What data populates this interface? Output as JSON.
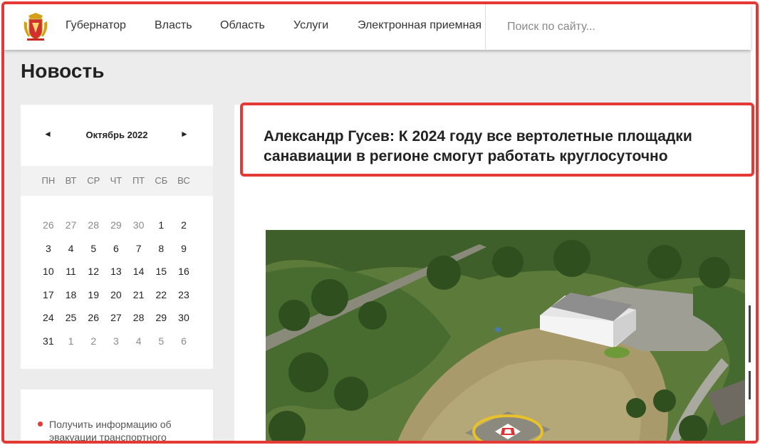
{
  "header": {
    "nav": [
      {
        "label": "Губернатор"
      },
      {
        "label": "Власть"
      },
      {
        "label": "Область"
      },
      {
        "label": "Услуги"
      },
      {
        "label": "Электронная приемная"
      }
    ],
    "search_placeholder": "Поиск по сайту..."
  },
  "page": {
    "title": "Новость"
  },
  "calendar": {
    "prev": "◄",
    "next": "►",
    "month": "Октябрь 2022",
    "weekdays": [
      "ПН",
      "ВТ",
      "СР",
      "ЧТ",
      "ПТ",
      "СБ",
      "ВС"
    ],
    "weeks": [
      [
        "26",
        "27",
        "28",
        "29",
        "30",
        "1",
        "2"
      ],
      [
        "3",
        "4",
        "5",
        "6",
        "7",
        "8",
        "9"
      ],
      [
        "10",
        "11",
        "12",
        "13",
        "14",
        "15",
        "16"
      ],
      [
        "17",
        "18",
        "19",
        "20",
        "21",
        "22",
        "23"
      ],
      [
        "24",
        "25",
        "26",
        "27",
        "28",
        "29",
        "30"
      ],
      [
        "31",
        "1",
        "2",
        "3",
        "4",
        "5",
        "6"
      ]
    ]
  },
  "sidebar": {
    "link": "Получить информацию об эвакуации транспортного"
  },
  "article": {
    "headline_line1": "Александр Гусев: К 2024 году все вертолетные площадки",
    "headline_line2": "санавиации в регионе смогут работать круглосуточно"
  },
  "colors": {
    "accent": "#e53935",
    "background": "#ececec"
  },
  "icons": {
    "logo": "coat-of-arms-icon",
    "photo": "helipad-aerial-photo"
  }
}
